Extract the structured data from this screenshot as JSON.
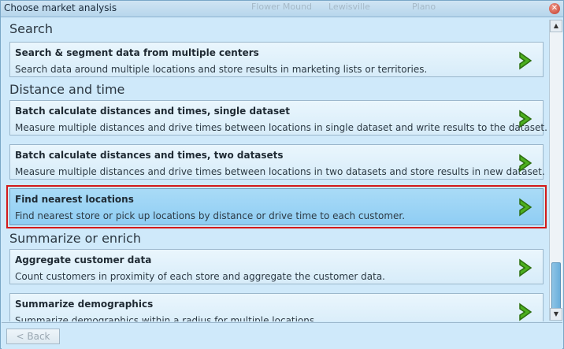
{
  "window": {
    "title": "Choose market analysis",
    "map_labels": [
      "Flower Mound",
      "Lewisville",
      "Plano"
    ]
  },
  "sections": [
    {
      "title": "Search",
      "items": [
        {
          "title": "Search & segment data from multiple centers",
          "desc": "Search data around multiple locations and store results in marketing lists or territories.",
          "selected": false
        }
      ]
    },
    {
      "title": "Distance and time",
      "items": [
        {
          "title": "Batch calculate distances and times, single dataset",
          "desc": "Measure multiple distances and drive times between locations in single dataset and write results to the dataset.",
          "selected": false
        },
        {
          "title": "Batch calculate distances and times, two datasets",
          "desc": "Measure multiple distances and drive times between locations in two datasets and store results in new dataset.",
          "selected": false
        },
        {
          "title": "Find nearest locations",
          "desc": "Find nearest store or pick up locations by distance or drive time to each customer.",
          "selected": true
        }
      ]
    },
    {
      "title": "Summarize or enrich",
      "items": [
        {
          "title": "Aggregate customer data",
          "desc": "Count customers in proximity of each store and aggregate the customer data.",
          "selected": false
        },
        {
          "title": "Summarize demographics",
          "desc": "Summarize demographics within a radius for multiple locations.",
          "selected": false
        }
      ]
    }
  ],
  "footer": {
    "back_label": "< Back"
  },
  "colors": {
    "selected_outline": "#d31a1a",
    "arrow_green": "#4caf1f"
  }
}
